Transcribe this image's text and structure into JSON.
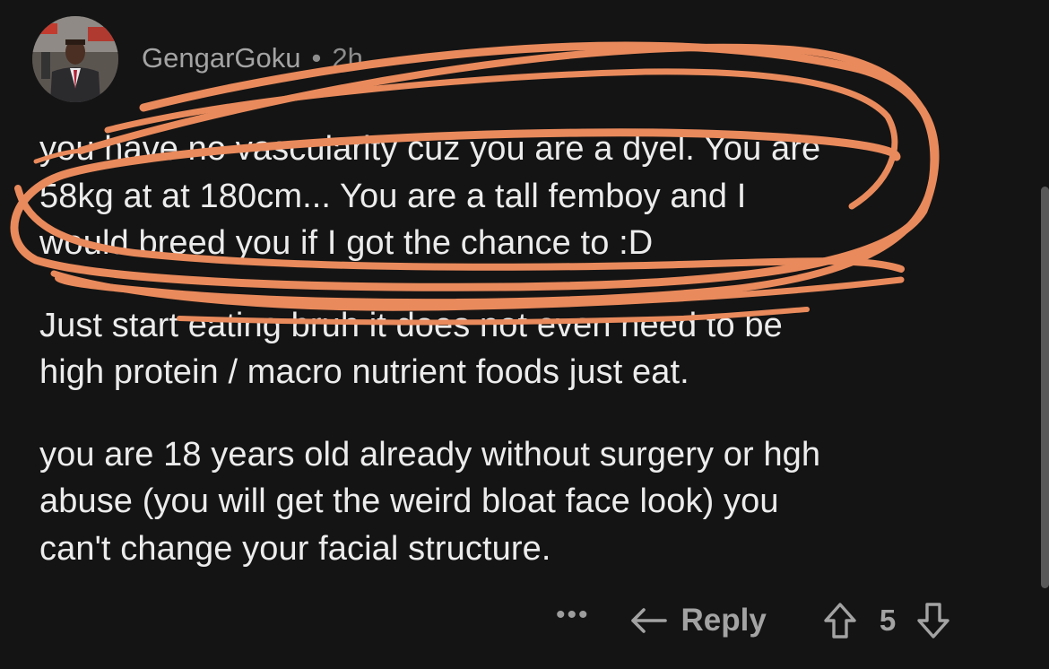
{
  "comment": {
    "author": "GengarGoku",
    "separator": "•",
    "time_ago": "2h",
    "paragraphs": [
      {
        "lines": [
          "you have no vascularity cuz you are a dyel. You are",
          "58kg at at 180cm... You are a tall femboy and I",
          "would breed you if I got the chance to :D"
        ]
      },
      {
        "lines": [
          "Just start eating bruh it does not even need to be",
          "high protein / macro nutrient foods just eat."
        ]
      },
      {
        "lines": [
          "you are 18 years old already without surgery or hgh",
          "abuse (you will get the weird bloat face look) you",
          "can't change your facial structure."
        ]
      }
    ]
  },
  "actions": {
    "more_label": "•••",
    "reply_label": "Reply",
    "vote_count": "5"
  },
  "icons": {
    "more": "more-dots-icon",
    "reply": "reply-arrow-icon",
    "upvote": "upvote-arrow-icon",
    "downvote": "downvote-arrow-icon"
  },
  "colors": {
    "background": "#141414",
    "text": "#ececec",
    "meta": "#9a9a9a",
    "annotation": "#e98a5c"
  }
}
